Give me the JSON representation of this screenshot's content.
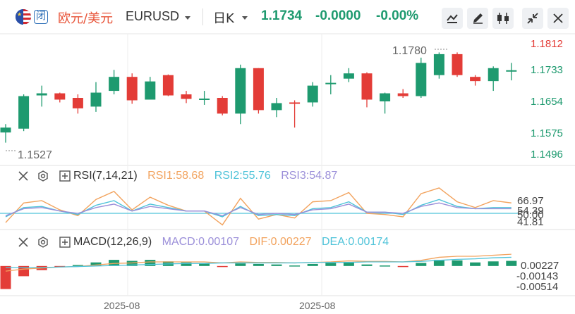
{
  "header": {
    "badge": "闭",
    "symbol_cn": "欧元/美元",
    "symbol_en": "EURUSD",
    "period": "日K",
    "last_price": "1.1734",
    "change": "-0.0000",
    "change_pct": "-0.00%"
  },
  "colors": {
    "up": "#1e9a6f",
    "down": "#e33c37",
    "rsi1": "#f2a35e",
    "rsi2": "#4fc3d9",
    "rsi3": "#9b8fd9",
    "dif": "#f2a35e",
    "dea": "#4fc3d9"
  },
  "main": {
    "y_labels": [
      "1.1812",
      "1.1733",
      "1.1654",
      "1.1575",
      "1.1496"
    ],
    "high_label": "1.1780",
    "low_label": "1.1527"
  },
  "rsi": {
    "name": "RSI(7,14,21)",
    "rsi1": "RSI1:58.68",
    "rsi2": "RSI2:55.76",
    "rsi3": "RSI3:54.87",
    "y_labels": [
      "66.97",
      "54.39",
      "50.00",
      "41.81"
    ]
  },
  "macd": {
    "name": "MACD(12,26,9)",
    "macd": "MACD:0.00107",
    "dif": "DIF:0.00227",
    "dea": "DEA:0.00174",
    "y_labels": [
      "0.00227",
      "-0.00143",
      "-0.00514"
    ]
  },
  "dates": [
    "2025-08",
    "2025-08"
  ],
  "chart_data": {
    "type": "candlestick",
    "ylim": [
      1.1496,
      1.1812
    ],
    "candles": [
      {
        "o": 1.1556,
        "h": 1.158,
        "l": 1.1527,
        "c": 1.157
      },
      {
        "o": 1.1567,
        "h": 1.1665,
        "l": 1.156,
        "c": 1.166
      },
      {
        "o": 1.1662,
        "h": 1.169,
        "l": 1.163,
        "c": 1.1668
      },
      {
        "o": 1.1668,
        "h": 1.167,
        "l": 1.1642,
        "c": 1.165
      },
      {
        "o": 1.1655,
        "h": 1.1665,
        "l": 1.161,
        "c": 1.1625
      },
      {
        "o": 1.163,
        "h": 1.17,
        "l": 1.1615,
        "c": 1.167
      },
      {
        "o": 1.1675,
        "h": 1.1735,
        "l": 1.1665,
        "c": 1.1715
      },
      {
        "o": 1.1715,
        "h": 1.1725,
        "l": 1.1638,
        "c": 1.1648
      },
      {
        "o": 1.165,
        "h": 1.1715,
        "l": 1.165,
        "c": 1.1702
      },
      {
        "o": 1.172,
        "h": 1.1722,
        "l": 1.166,
        "c": 1.1662
      },
      {
        "o": 1.1665,
        "h": 1.1675,
        "l": 1.164,
        "c": 1.1652
      },
      {
        "o": 1.1653,
        "h": 1.1675,
        "l": 1.1635,
        "c": 1.1653
      },
      {
        "o": 1.1655,
        "h": 1.166,
        "l": 1.1605,
        "c": 1.161
      },
      {
        "o": 1.161,
        "h": 1.175,
        "l": 1.158,
        "c": 1.174
      },
      {
        "o": 1.174,
        "h": 1.174,
        "l": 1.161,
        "c": 1.162
      },
      {
        "o": 1.162,
        "h": 1.1655,
        "l": 1.16,
        "c": 1.164
      },
      {
        "o": 1.1642,
        "h": 1.1648,
        "l": 1.157,
        "c": 1.164
      },
      {
        "o": 1.1642,
        "h": 1.17,
        "l": 1.163,
        "c": 1.169
      },
      {
        "o": 1.1695,
        "h": 1.172,
        "l": 1.1665,
        "c": 1.1698
      },
      {
        "o": 1.171,
        "h": 1.174,
        "l": 1.17,
        "c": 1.1725
      },
      {
        "o": 1.1725,
        "h": 1.1728,
        "l": 1.1628,
        "c": 1.165
      },
      {
        "o": 1.1645,
        "h": 1.167,
        "l": 1.161,
        "c": 1.1668
      },
      {
        "o": 1.1668,
        "h": 1.168,
        "l": 1.1655,
        "c": 1.166
      },
      {
        "o": 1.166,
        "h": 1.177,
        "l": 1.1655,
        "c": 1.1755
      },
      {
        "o": 1.172,
        "h": 1.1785,
        "l": 1.171,
        "c": 1.178
      },
      {
        "o": 1.178,
        "h": 1.1785,
        "l": 1.1715,
        "c": 1.172
      },
      {
        "o": 1.1715,
        "h": 1.172,
        "l": 1.169,
        "c": 1.1703
      },
      {
        "o": 1.1703,
        "h": 1.1745,
        "l": 1.1675,
        "c": 1.174
      },
      {
        "o": 1.1734,
        "h": 1.1755,
        "l": 1.1705,
        "c": 1.1734
      }
    ],
    "rsi": {
      "ylim": [
        36,
        75
      ],
      "rsi1": [
        42,
        59,
        61,
        53,
        48,
        62,
        69,
        53,
        64,
        57,
        52,
        52,
        40,
        63,
        45,
        49,
        46,
        60,
        61,
        68,
        50,
        49,
        47,
        67,
        72,
        60,
        55,
        61,
        59
      ],
      "rsi2": [
        47,
        55,
        56,
        52,
        49,
        57,
        61,
        52,
        58,
        55,
        52,
        52,
        47,
        56,
        48,
        49,
        48,
        54,
        55,
        60,
        51,
        51,
        49,
        57,
        62,
        56,
        54,
        55,
        55
      ],
      "rsi3": [
        48,
        54,
        55,
        52,
        50,
        55,
        58,
        52,
        56,
        54,
        52,
        52,
        48,
        55,
        49,
        50,
        49,
        53,
        54,
        58,
        51,
        51,
        50,
        56,
        59,
        55,
        54,
        54,
        54
      ]
    },
    "macd": {
      "ylim": [
        -0.0058,
        0.003
      ],
      "hist": [
        -0.0045,
        -0.002,
        -0.0008,
        -0.0002,
        0.0002,
        0.0007,
        0.0012,
        0.001,
        0.0012,
        0.0009,
        0.0007,
        0.0006,
        -0.0002,
        0.0005,
        0.0004,
        0.0003,
        0.0001,
        0.0004,
        0.0006,
        0.0008,
        0.0003,
        0.0001,
        -0.0002,
        0.0006,
        0.0012,
        0.0011,
        0.0007,
        0.0009,
        0.001
      ],
      "dif": [
        -0.001,
        -0.0006,
        -0.0004,
        -0.0002,
        -0.0001,
        0.0002,
        0.0005,
        0.0006,
        0.0008,
        0.0008,
        0.0008,
        0.0008,
        0.0006,
        0.0008,
        0.0007,
        0.0007,
        0.0006,
        0.0007,
        0.0008,
        0.001,
        0.0009,
        0.0009,
        0.0008,
        0.0011,
        0.0017,
        0.0019,
        0.0019,
        0.0021,
        0.0023
      ],
      "dea": [
        -0.0003,
        -0.0003,
        -0.0003,
        -0.0002,
        -0.0001,
        0.0,
        0.0001,
        0.0002,
        0.0003,
        0.0004,
        0.0005,
        0.0005,
        0.0006,
        0.0006,
        0.0006,
        0.0006,
        0.0006,
        0.0007,
        0.0007,
        0.0007,
        0.0008,
        0.0008,
        0.0008,
        0.0009,
        0.0011,
        0.0013,
        0.0014,
        0.0016,
        0.0017
      ]
    }
  }
}
